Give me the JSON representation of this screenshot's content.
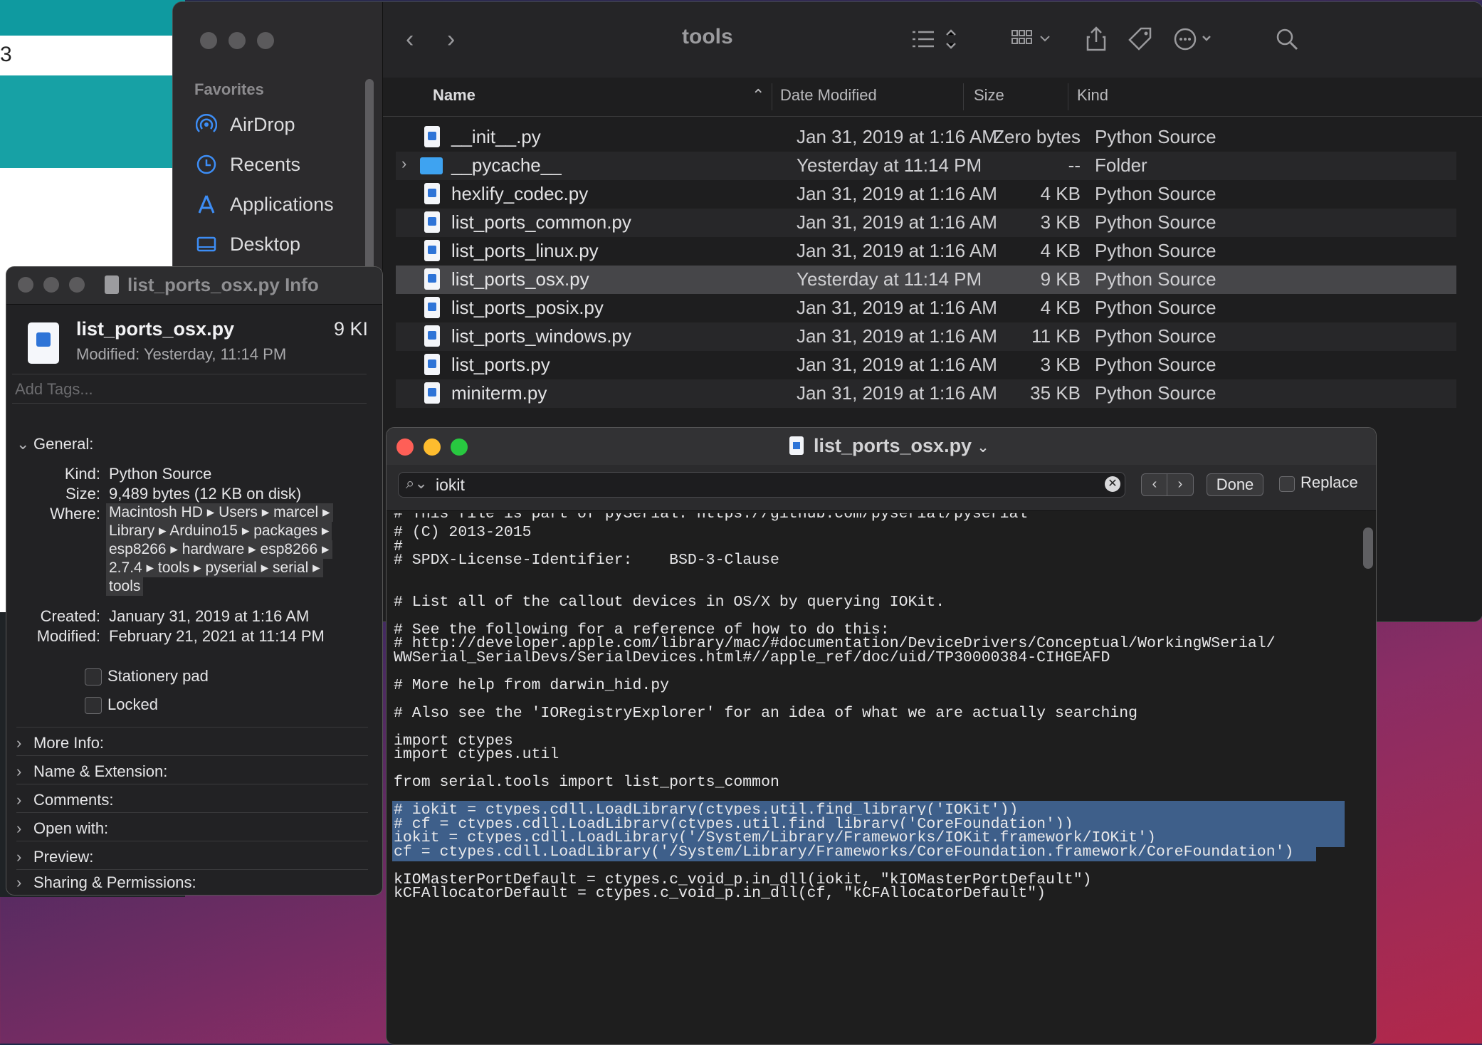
{
  "background_app": {
    "partial_text": "3"
  },
  "finder": {
    "title": "tools",
    "sidebar": {
      "heading": "Favorites",
      "items": [
        {
          "label": "AirDrop",
          "icon": "airdrop-icon"
        },
        {
          "label": "Recents",
          "icon": "clock-icon"
        },
        {
          "label": "Applications",
          "icon": "applications-icon"
        },
        {
          "label": "Desktop",
          "icon": "desktop-icon"
        }
      ]
    },
    "columns": {
      "name": "Name",
      "date": "Date Modified",
      "size": "Size",
      "kind": "Kind"
    },
    "files": [
      {
        "name": "__init__.py",
        "date": "Jan 31, 2019 at 1:16 AM",
        "size": "Zero bytes",
        "kind": "Python Source"
      },
      {
        "name": "__pycache__",
        "date": "Yesterday at 11:14 PM",
        "size": "--",
        "kind": "Folder"
      },
      {
        "name": "hexlify_codec.py",
        "date": "Jan 31, 2019 at 1:16 AM",
        "size": "4 KB",
        "kind": "Python Source"
      },
      {
        "name": "list_ports_common.py",
        "date": "Jan 31, 2019 at 1:16 AM",
        "size": "3 KB",
        "kind": "Python Source"
      },
      {
        "name": "list_ports_linux.py",
        "date": "Jan 31, 2019 at 1:16 AM",
        "size": "4 KB",
        "kind": "Python Source"
      },
      {
        "name": "list_ports_osx.py",
        "date": "Yesterday at 11:14 PM",
        "size": "9 KB",
        "kind": "Python Source"
      },
      {
        "name": "list_ports_posix.py",
        "date": "Jan 31, 2019 at 1:16 AM",
        "size": "4 KB",
        "kind": "Python Source"
      },
      {
        "name": "list_ports_windows.py",
        "date": "Jan 31, 2019 at 1:16 AM",
        "size": "11 KB",
        "kind": "Python Source"
      },
      {
        "name": "list_ports.py",
        "date": "Jan 31, 2019 at 1:16 AM",
        "size": "3 KB",
        "kind": "Python Source"
      },
      {
        "name": "miniterm.py",
        "date": "Jan 31, 2019 at 1:16 AM",
        "size": "35 KB",
        "kind": "Python Source"
      }
    ]
  },
  "info": {
    "window_title": "list_ports_osx.py Info",
    "filename": "list_ports_osx.py",
    "filesize": "9 KI",
    "modified_line": "Modified: Yesterday, 11:14 PM",
    "tags_placeholder": "Add Tags...",
    "general": "General:",
    "kind_label": "Kind:",
    "kind": "Python Source",
    "size_label": "Size:",
    "size": "9,489 bytes (12 KB on disk)",
    "where_label": "Where:",
    "where_lines": [
      "Macintosh HD ▸ Users ▸ marcel ▸",
      "Library ▸ Arduino15 ▸ packages ▸",
      "esp8266 ▸ hardware ▸ esp8266 ▸",
      "2.7.4 ▸ tools ▸ pyserial ▸ serial ▸",
      "tools"
    ],
    "created_label": "Created:",
    "created": "January 31, 2019 at 1:16 AM",
    "modified_label": "Modified:",
    "modified": "February 21, 2021 at 11:14 PM",
    "stationery": "Stationery pad",
    "locked": "Locked",
    "sections": [
      "More Info:",
      "Name & Extension:",
      "Comments:",
      "Open with:",
      "Preview:",
      "Sharing & Permissions:"
    ]
  },
  "editor": {
    "title": "list_ports_osx.py",
    "find": {
      "value": "iokit",
      "done": "Done",
      "replace": "Replace"
    },
    "lines": [
      "# This file is part of pySerial. https://github.com/pyserial/pyserial",
      "# (C) 2013-2015",
      "#",
      "# SPDX-License-Identifier:    BSD-3-Clause",
      "",
      "",
      "# List all of the callout devices in OS/X by querying IOKit.",
      "",
      "# See the following for a reference of how to do this:",
      "# http://developer.apple.com/library/mac/#documentation/DeviceDrivers/Conceptual/WorkingWSerial/",
      "WWSerial_SerialDevs/SerialDevices.html#//apple_ref/doc/uid/TP30000384-CIHGEAFD",
      "",
      "# More help from darwin_hid.py",
      "",
      "# Also see the 'IORegistryExplorer' for an idea of what we are actually searching",
      "",
      "import ctypes",
      "import ctypes.util",
      "",
      "from serial.tools import list_ports_common",
      "",
      "# iokit = ctypes.cdll.LoadLibrary(ctypes.util.find_library('IOKit'))",
      "# cf = ctypes.cdll.LoadLibrary(ctypes.util.find_library('CoreFoundation'))",
      "iokit = ctypes.cdll.LoadLibrary('/System/Library/Frameworks/IOKit.framework/IOKit')",
      "cf = ctypes.cdll.LoadLibrary('/System/Library/Frameworks/CoreFoundation.framework/CoreFoundation')",
      "",
      "kIOMasterPortDefault = ctypes.c_void_p.in_dll(iokit, \"kIOMasterPortDefault\")",
      "kCFAllocatorDefault = ctypes.c_void_p.in_dll(cf, \"kCFAllocatorDefault\")"
    ]
  }
}
